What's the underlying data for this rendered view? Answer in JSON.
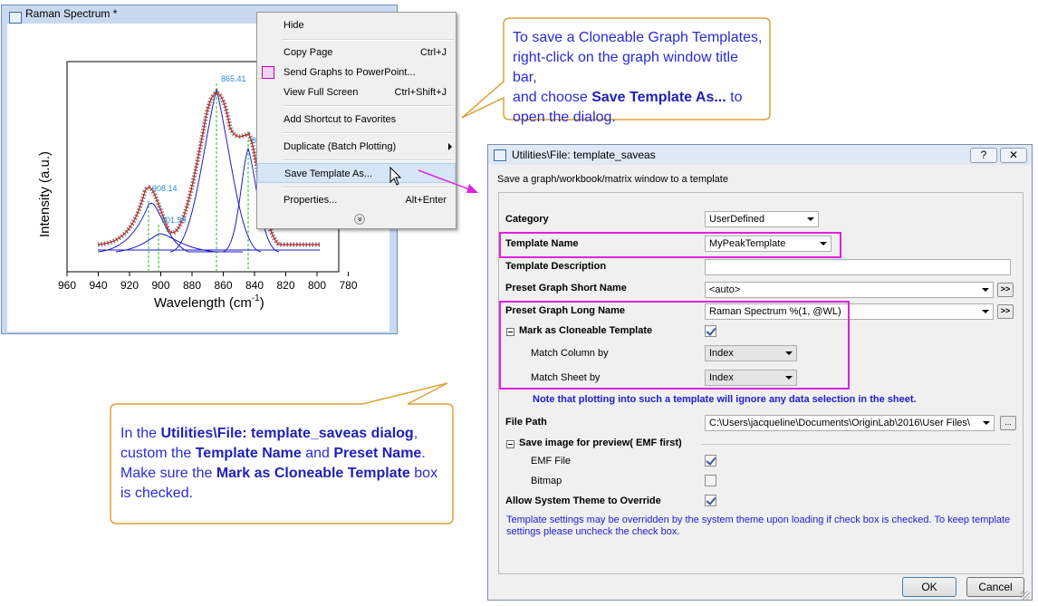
{
  "graph_window": {
    "title": "Raman Spectrum *",
    "layer_index": "1",
    "ylabel": "Intensity (a.u.)",
    "xlabel": "Wavelength (cm",
    "xlabel_sup": "-1",
    "xlabel_close": ")",
    "x_ticks": [
      "960",
      "940",
      "920",
      "900",
      "880",
      "860",
      "840",
      "820",
      "800",
      "780"
    ],
    "peak_labels": [
      "865.41",
      "908.14",
      "901.59",
      "8"
    ]
  },
  "context_menu": {
    "items": [
      {
        "label": "Hide",
        "shortcut": ""
      },
      {
        "label": "Copy Page",
        "shortcut": "Ctrl+J"
      },
      {
        "label": "Send Graphs to PowerPoint...",
        "shortcut": ""
      },
      {
        "label": "View Full Screen",
        "shortcut": "Ctrl+Shift+J"
      },
      {
        "label": "Add Shortcut to Favorites",
        "shortcut": ""
      },
      {
        "label": "Duplicate (Batch Plotting)",
        "shortcut": ""
      },
      {
        "label": "Save Template As...",
        "shortcut": ""
      },
      {
        "label": "Properties...",
        "shortcut": "Alt+Enter"
      }
    ],
    "more_glyph": "»"
  },
  "callout_top": {
    "line1": "To save a Cloneable Graph Templates,",
    "line2": "right-click on the graph window title bar,",
    "line3_pre": "and choose ",
    "line3_bold": "Save Template As...",
    "line3_post": " to",
    "line4": "open the dialog."
  },
  "callout_bottom": {
    "l1_pre": "In the ",
    "l1_bold": "Utilities\\File: template_saveas dialog",
    "l1_post": ",",
    "l2_pre": "custom the ",
    "l2_bold1": "Template Name",
    "l2_mid": " and ",
    "l2_bold2": "Preset Name",
    "l2_post": ".",
    "l3_pre": "Make sure the ",
    "l3_bold": "Mark as Cloneable Template",
    "l3_post": " box",
    "l4": "is checked."
  },
  "dialog": {
    "title": "Utilities\\File: template_saveas",
    "help_btn": "?",
    "close_btn": "✕",
    "description": "Save a graph/workbook/matrix window to a template",
    "category_label": "Category",
    "category_value": "UserDefined",
    "template_name_label": "Template Name",
    "template_name_value": "MyPeakTemplate",
    "template_desc_label": "Template Description",
    "short_name_label": "Preset Graph Short Name",
    "short_name_value": "<auto>",
    "long_name_label": "Preset Graph Long Name",
    "long_name_value": "Raman Spectrum %(1, @WL)",
    "more_btn": ">>",
    "cloneable_label": "Mark as Cloneable Template",
    "match_column_label": "Match Column by",
    "match_column_value": "Index",
    "match_sheet_label": "Match Sheet by",
    "match_sheet_value": "Index",
    "note": "Note that plotting into such a template will ignore any data selection in the sheet.",
    "file_path_label": "File Path",
    "file_path_value": "C:\\Users\\jacqueline\\Documents\\OriginLab\\2016\\User Files\\",
    "browse_btn": "...",
    "save_image_label": "Save image for preview( EMF first)",
    "emf_label": "EMF File",
    "bitmap_label": "Bitmap",
    "allow_theme_label": "Allow System Theme to Override",
    "help_line1": "Template settings may be overridden by the system theme upon loading if check box is checked. To keep template",
    "help_line2": "settings please uncheck the check box.",
    "ok_btn": "OK",
    "cancel_btn": "Cancel"
  },
  "colors": {
    "highlight": "#e020e0",
    "callout_border": "#d9a23a",
    "callout_text": "#2a2ad6"
  }
}
